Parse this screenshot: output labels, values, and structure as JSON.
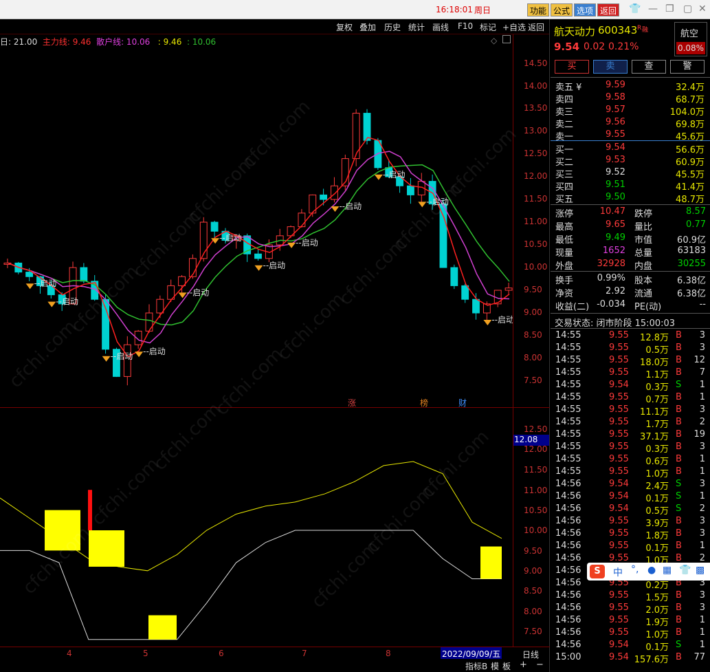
{
  "titlebar": {
    "time": "16:18:01",
    "day": "周日",
    "buttons": [
      "功能",
      "公式",
      "选项",
      "返回"
    ]
  },
  "toolbar": {
    "items": [
      "复权",
      "叠加",
      "历史",
      "统计",
      "画线",
      "F10",
      "标记",
      "+自选",
      "返回"
    ]
  },
  "legend": {
    "period": "日: 21.00",
    "main_line": "主力线: 9.46",
    "retail_line": "散户线: 10.06",
    "v1": ": 9.46",
    "v2": ": 10.06"
  },
  "main_axis": [
    "14.50",
    "14.00",
    "13.50",
    "13.00",
    "12.50",
    "12.00",
    "11.50",
    "11.00",
    "10.50",
    "10.00",
    "9.50",
    "9.00",
    "8.50",
    "8.00",
    "7.50"
  ],
  "sub_axis": [
    "12.50",
    "12.00",
    "11.50",
    "11.00",
    "10.50",
    "10.00",
    "9.50",
    "9.00",
    "8.50",
    "8.00",
    "7.50"
  ],
  "sub_axis_current": "12.08",
  "event_labels": [
    {
      "label": "涨",
      "color": "#d04040"
    },
    {
      "label": "榜",
      "color": "#e08020"
    },
    {
      "label": "财",
      "color": "#4090ff"
    }
  ],
  "signal_label": "启动",
  "date_axis": {
    "ticks": [
      "4",
      "5",
      "6",
      "7",
      "8"
    ],
    "current_date": "2022/09/09/五",
    "period_button": "日线"
  },
  "bottombar": {
    "items": [
      "指标B",
      "模",
      "板",
      "+",
      "−"
    ]
  },
  "stock": {
    "name": "航天动力",
    "code": "600343",
    "flag": "R",
    "margin_flag": "融",
    "price": "9.54",
    "change": "0.02",
    "change_pct": "0.21%",
    "sector": "航空",
    "sector_pct": "0.08%"
  },
  "trade_buttons": [
    "买",
    "卖",
    "查",
    "警"
  ],
  "order_book": {
    "asks": [
      {
        "label": "卖五 ¥",
        "price": "9.59",
        "vol": "32.4万"
      },
      {
        "label": "卖四",
        "price": "9.58",
        "vol": "68.7万"
      },
      {
        "label": "卖三",
        "price": "9.57",
        "vol": "104.0万"
      },
      {
        "label": "卖二",
        "price": "9.56",
        "vol": "69.8万"
      },
      {
        "label": "卖一",
        "price": "9.55",
        "vol": "45.6万"
      }
    ],
    "bids": [
      {
        "label": "买一",
        "price": "9.54",
        "vol": "56.6万"
      },
      {
        "label": "买二",
        "price": "9.53",
        "vol": "60.9万"
      },
      {
        "label": "买三",
        "price": "9.52",
        "vol": "45.5万"
      },
      {
        "label": "买四",
        "price": "9.51",
        "vol": "41.4万"
      },
      {
        "label": "买五",
        "price": "9.50",
        "vol": "48.7万"
      }
    ]
  },
  "stats": [
    {
      "k1": "涨停",
      "v1": "10.47",
      "k2": "跌停",
      "v2": "8.57"
    },
    {
      "k1": "最高",
      "v1": "9.65",
      "k2": "量比",
      "v2": "0.77"
    },
    {
      "k1": "最低",
      "v1": "9.49",
      "k2": "市值",
      "v2": "60.9亿"
    },
    {
      "k1": "现量",
      "v1": "1652",
      "k2": "总量",
      "v2": "63183"
    },
    {
      "k1": "外盘",
      "v1": "32928",
      "k2": "内盘",
      "v2": "30255"
    }
  ],
  "stats2": [
    {
      "k1": "换手",
      "v1": "0.99%",
      "k2": "股本",
      "v2": "6.38亿"
    },
    {
      "k1": "净资",
      "v1": "2.92",
      "k2": "流通",
      "v2": "6.38亿"
    },
    {
      "k1": "收益(二)",
      "v1": "-0.034",
      "k2": "PE(动)",
      "v2": "--"
    }
  ],
  "trade_status": "交易状态: 闭市阶段 15:00:03",
  "ticks": [
    {
      "t": "14:55",
      "p": "9.55",
      "v": "12.8万",
      "d": "B",
      "n": "3"
    },
    {
      "t": "14:55",
      "p": "9.55",
      "v": "0.5万",
      "d": "B",
      "n": "3"
    },
    {
      "t": "14:55",
      "p": "9.55",
      "v": "18.0万",
      "d": "B",
      "n": "12"
    },
    {
      "t": "14:55",
      "p": "9.55",
      "v": "1.1万",
      "d": "B",
      "n": "7"
    },
    {
      "t": "14:55",
      "p": "9.54",
      "v": "0.3万",
      "d": "S",
      "n": "1"
    },
    {
      "t": "14:55",
      "p": "9.55",
      "v": "0.7万",
      "d": "B",
      "n": "1"
    },
    {
      "t": "14:55",
      "p": "9.55",
      "v": "11.1万",
      "d": "B",
      "n": "3"
    },
    {
      "t": "14:55",
      "p": "9.55",
      "v": "1.7万",
      "d": "B",
      "n": "2"
    },
    {
      "t": "14:55",
      "p": "9.55",
      "v": "37.1万",
      "d": "B",
      "n": "19"
    },
    {
      "t": "14:55",
      "p": "9.55",
      "v": "0.3万",
      "d": "B",
      "n": "3"
    },
    {
      "t": "14:55",
      "p": "9.55",
      "v": "0.6万",
      "d": "B",
      "n": "1"
    },
    {
      "t": "14:55",
      "p": "9.55",
      "v": "1.0万",
      "d": "B",
      "n": "1"
    },
    {
      "t": "14:56",
      "p": "9.54",
      "v": "2.4万",
      "d": "S",
      "n": "3"
    },
    {
      "t": "14:56",
      "p": "9.54",
      "v": "0.1万",
      "d": "S",
      "n": "1"
    },
    {
      "t": "14:56",
      "p": "9.54",
      "v": "0.5万",
      "d": "S",
      "n": "2"
    },
    {
      "t": "14:56",
      "p": "9.55",
      "v": "3.9万",
      "d": "B",
      "n": "3"
    },
    {
      "t": "14:56",
      "p": "9.55",
      "v": "1.8万",
      "d": "B",
      "n": "3"
    },
    {
      "t": "14:56",
      "p": "9.55",
      "v": "0.1万",
      "d": "B",
      "n": "1"
    },
    {
      "t": "14:56",
      "p": "9.55",
      "v": "1.0万",
      "d": "B",
      "n": "2"
    },
    {
      "t": "14:56",
      "p": "9.55",
      "v": "",
      "d": "",
      "n": ""
    },
    {
      "t": "14:56",
      "p": "9.55",
      "v": "0.2万",
      "d": "B",
      "n": "3"
    },
    {
      "t": "14:56",
      "p": "9.55",
      "v": "1.5万",
      "d": "B",
      "n": "3"
    },
    {
      "t": "14:56",
      "p": "9.55",
      "v": "2.0万",
      "d": "B",
      "n": "3"
    },
    {
      "t": "14:56",
      "p": "9.55",
      "v": "1.9万",
      "d": "B",
      "n": "1"
    },
    {
      "t": "14:56",
      "p": "9.55",
      "v": "1.0万",
      "d": "B",
      "n": "1"
    },
    {
      "t": "14:56",
      "p": "9.54",
      "v": "0.1万",
      "d": "S",
      "n": "1"
    },
    {
      "t": "15:00",
      "p": "9.54",
      "v": "157.6万",
      "d": "B",
      "n": "77"
    }
  ],
  "ime": {
    "label": "中"
  },
  "watermark": "cfchi.com",
  "colors": {
    "up": "#ff3b3b",
    "down": "#00d2d2",
    "ma_main": "#ff2020",
    "ma_retail": "#d040d0",
    "ma_long": "#30c030",
    "signal": "#e8e800"
  }
}
